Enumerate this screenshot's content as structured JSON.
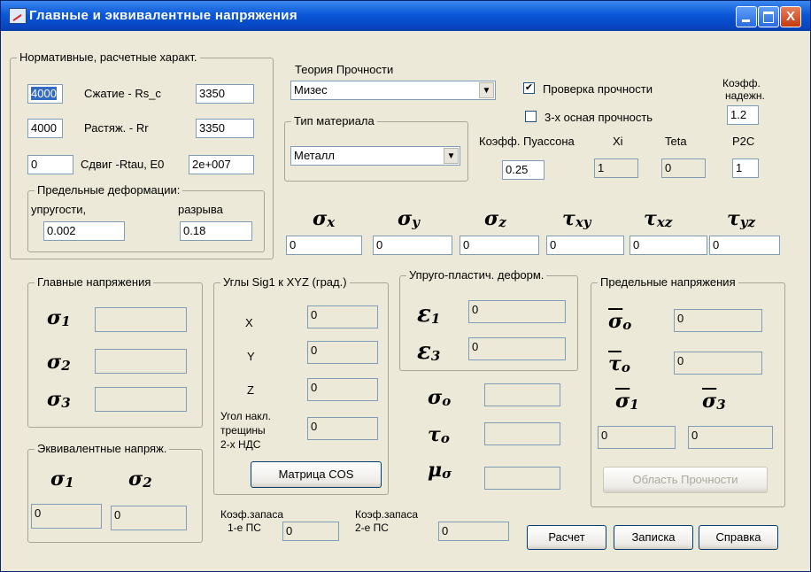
{
  "window": {
    "title": "Главные и эквивалентные напряжения",
    "controls": {
      "minimize": "_",
      "maximize": "□",
      "close": "X"
    }
  },
  "norm": {
    "title": "Нормативные, расчетные характ.",
    "compression": {
      "label": "Сжатие - Rs_c",
      "value1": "4000",
      "value2": "3350"
    },
    "tension": {
      "label": "Растяж. - Rr",
      "value1": "4000",
      "value2": "3350"
    },
    "shear": {
      "label": "Сдвиг -Rtau, E0",
      "value1": "0",
      "value2": "2e+007"
    },
    "deform": {
      "title": "Предельные деформации:",
      "elastic_label": "упругости,",
      "rupture_label": "разрыва",
      "elastic_value": "0.002",
      "rupture_value": "0.18"
    }
  },
  "theory": {
    "label": "Теория Прочности",
    "selected": "Мизес"
  },
  "material": {
    "title": "Тип материала",
    "selected": "Металл"
  },
  "checks": {
    "strength_check": {
      "label": "Проверка прочности",
      "checked": true,
      "mark": "✔"
    },
    "triaxial": {
      "label": "3-х осная прочность",
      "checked": false
    }
  },
  "params": {
    "reliability_label_1": "Коэфф.",
    "reliability_label_2": "надежн.",
    "reliability_value": "1.2",
    "poisson_label": "Коэфф. Пуассона",
    "poisson_value": "0.25",
    "xi_label": "Xi",
    "xi_value": "1",
    "teta_label": "Teta",
    "teta_value": "0",
    "p2c_label": "P2C",
    "p2c_value": "1"
  },
  "stresses": [
    {
      "symbol": "σ",
      "sub": "x",
      "value": "0"
    },
    {
      "symbol": "σ",
      "sub": "y",
      "value": "0"
    },
    {
      "symbol": "σ",
      "sub": "z",
      "value": "0"
    },
    {
      "symbol": "τ",
      "sub": "xy",
      "value": "0"
    },
    {
      "symbol": "τ",
      "sub": "xz",
      "value": "0"
    },
    {
      "symbol": "τ",
      "sub": "yz",
      "value": "0"
    }
  ],
  "principal": {
    "title": "Главные напряжения",
    "rows": [
      {
        "symbol": "σ",
        "sub": "1",
        "value": ""
      },
      {
        "symbol": "σ",
        "sub": "2",
        "value": ""
      },
      {
        "symbol": "σ",
        "sub": "3",
        "value": ""
      }
    ]
  },
  "angles": {
    "title": "Углы Sig1  к  XYZ (град.)",
    "x_label": "X",
    "x_value": "0",
    "y_label": "Y",
    "y_value": "0",
    "z_label": "Z",
    "z_value": "0",
    "crack_label_1": "Угол накл.",
    "crack_label_2": "трещины",
    "crack_label_3": "2-х НДС",
    "crack_value": "0",
    "matrix_button": "Матрица COS"
  },
  "plastic": {
    "title": "Упруго-пластич. деформ.",
    "e1_symbol": "ε",
    "e1_sub": "1",
    "e1_value": "0",
    "e3_symbol": "ε",
    "e3_sub": "3",
    "e3_value": "0"
  },
  "octa": {
    "sigma_symbol": "σ",
    "sigma_sub": "o",
    "sigma_value": "",
    "tau_symbol": "τ",
    "tau_sub": "o",
    "tau_value": "",
    "mu_symbol": "μ",
    "mu_sub": "σ",
    "mu_value": ""
  },
  "limit": {
    "title": "Предельные напряжения",
    "sigma0_symbol": "σ",
    "sigma0_sub": "o",
    "sigma0_value": "0",
    "tau0_symbol": "τ",
    "tau0_sub": "o",
    "tau0_value": "0",
    "sigma1_symbol": "σ",
    "sigma1_sub": "1",
    "sigma1_value": "0",
    "sigma3_symbol": "σ",
    "sigma3_sub": "3",
    "sigma3_value": "0",
    "region_button": "Область Прочности"
  },
  "equiv": {
    "title": "Эквивалентные напряж.",
    "s1_symbol": "σ",
    "s1_sub": "1",
    "s1_value": "0",
    "s2_symbol": "σ",
    "s2_sub": "2",
    "s2_value": "0"
  },
  "safety": {
    "k1_label_1": "Коэф.запаса",
    "k1_label_2": "1-е ПС",
    "k1_value": "0",
    "k2_label_1": "Коэф.запаса",
    "k2_label_2": "2-е ПС",
    "k2_value": "0"
  },
  "buttons": {
    "calc": "Расчет",
    "note": "Записка",
    "help": "Справка"
  }
}
